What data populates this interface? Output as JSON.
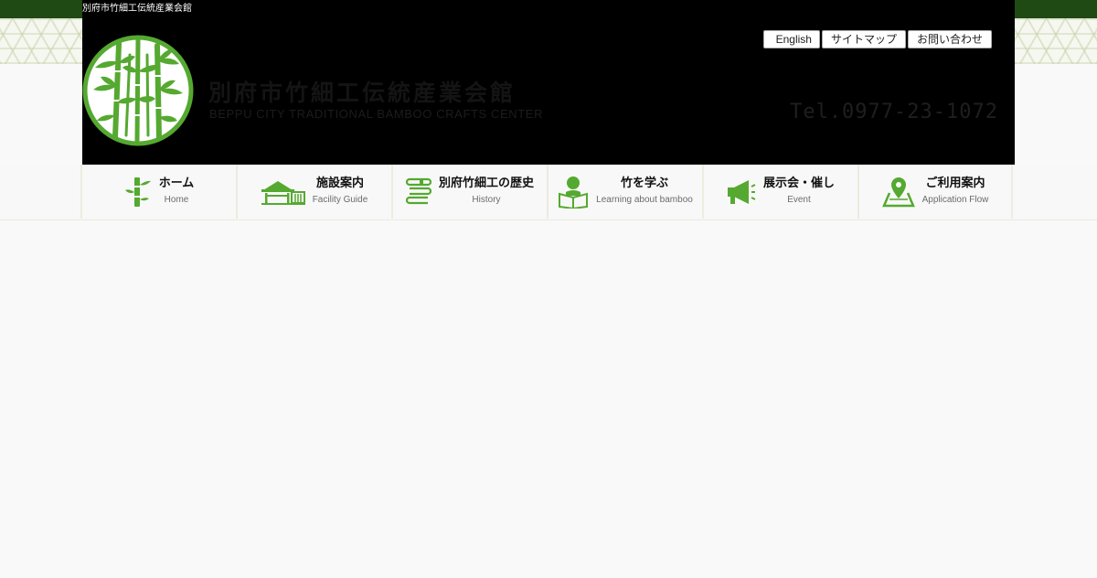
{
  "page": {
    "site_title_small": "別府市竹細工伝統産業会館",
    "colors": {
      "topbar": "#1f4a14",
      "header_bg": "#000000",
      "accent_green": "#55a930",
      "page_bg": "#f9f9f9"
    }
  },
  "header": {
    "logo_icon": "bamboo-circle-logo",
    "logo_jp": "別府市竹細工伝統産業会館",
    "logo_en": "BEPPU CITY TRADITIONAL BAMBOO CRAFTS CENTER",
    "tel": "Tel.0977-23-1072",
    "links": [
      {
        "label": "English"
      },
      {
        "label": "サイトマップ"
      },
      {
        "label": "お問い合わせ"
      }
    ]
  },
  "nav": {
    "items": [
      {
        "label": "ホーム",
        "sub": "Home",
        "icon": "bamboo-icon"
      },
      {
        "label": "施設案内",
        "sub": "Facility Guide",
        "icon": "building-icon"
      },
      {
        "label": "別府竹細工の歴史",
        "sub": "History",
        "icon": "books-icon"
      },
      {
        "label": "竹を学ぶ",
        "sub": "Learning about bamboo",
        "icon": "reader-icon"
      },
      {
        "label": "展示会・催し",
        "sub": "Event",
        "icon": "megaphone-icon"
      },
      {
        "label": "ご利用案内",
        "sub": "Application Flow",
        "icon": "map-pin-icon"
      }
    ]
  }
}
